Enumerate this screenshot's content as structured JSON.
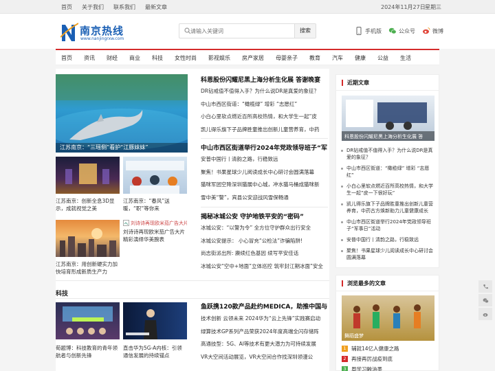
{
  "topbar": {
    "links": [
      "首页",
      "关于我们",
      "联系我们",
      "最新文章"
    ],
    "date": "2024年11月27日",
    "weekday": "星期三"
  },
  "logo": {
    "name": "南京热线",
    "domain": "www.nanjingrxw.com"
  },
  "search": {
    "placeholder": "请输入关键词",
    "button": "搜索"
  },
  "header_links": [
    "手机版",
    "公众号",
    "微博"
  ],
  "nav": [
    "首页",
    "资讯",
    "财经",
    "商业",
    "科技",
    "女性时尚",
    "影视娱乐",
    "房产家居",
    "母婴亲子",
    "教育",
    "汽车",
    "健康",
    "公益",
    "生活"
  ],
  "hero": {
    "caption": "江苏南京：“三瑶侧”看护“江豚妹妹”"
  },
  "thumbs": [
    {
      "caption": "江苏南京：创新全息3D显示，成就视觉之美"
    },
    {
      "caption": "江苏南京：“春风”送暖，“职”等你来"
    },
    {
      "caption": "江苏南京：用创新硬实力加快培育形成新质生产力"
    },
    {
      "caption": "刘诗诗再现欧米茄广告大片精彩演绎华美腕表",
      "alt": "刘诗诗再现欧米茄广告大片"
    }
  ],
  "news_groups": [
    {
      "lead": "科恩股份闪耀尼黑上海分析生化展 答谢晚宴",
      "items": [
        "DR钻戒值不值得入手？为什么说DR是真爱的象征？",
        "中山市西区街道：“橄榄绿” 增彩 “志愿红”",
        "小白心里软点燃近百所高校热情，和大学生一起”皮",
        "凯儿得乐旗下子品牌胜童推出创新儿童营养育，中药"
      ]
    },
    {
      "lead": "中山市西区街道举行2024年党政领导班子“军",
      "items": [
        "安普中国行丨清韵之路，行稳致远",
        "聚焦！书果星球少儿阅读成长中心研讨会圆满落幕",
        "猫咪军团空降深圳猫展中心城，冲水猫马桶成猫咪新",
        "雪中美“警”，宾县公安迎战风雪保畅通"
      ]
    },
    {
      "lead": "揭秘冰城公安 守护地铁平安的“密码”",
      "items": [
        "冰城公安：“以警为令” 全方位守护群众出行安全",
        "冰城公安提示： 小心冒充“公检法”诈骗陷阱!",
        "尚志街派出所: 赓续红色基因 续写平安佳话",
        "冰城公安“空中+地面”立体巡控 筑牢封江期冰面”安全"
      ]
    }
  ],
  "tech": {
    "title": "科技",
    "thumbs": [
      {
        "caption": "荀题博：科技教育的青年领航者与创新先锋"
      },
      {
        "caption": "直击华为5G-A内核：引领通信发展的持续锚点"
      }
    ],
    "lead": "鱼跃携120款产品赴约MEDICA，助推中国与",
    "items": [
      "技术创新 云领未来 2024华为“云上先锋”实践赛启动",
      "绿算技术GP系列产品荣获2024年度高端全闪存储阵",
      "高通技型：5G、AI等技术有更大潜力为可持续发展",
      "VR大空间活动展览，VR大空间合作找深圳领漫公"
    ]
  },
  "sidebar": {
    "recent_title": "近期文章",
    "recent_image_caption": "科恩股份闪耀尼黑上海分析生化展 答",
    "recent": [
      "DR钻戒值不值得入手？为什么说DR是真爱的象征？",
      "中山市西区街道：“橄榄绿” 增彩 “志愿红”",
      "小白心里软点燃近百所高校热情，和大学生一起”皮一下很好玩”",
      "凯儿得乐旗下子品牌胜童推出创新儿童营养育，中药古方焕新助力儿童健康成长",
      "中山市西区街道举行2024年党政领导班子“军事日”活动",
      "安普中国行丨清韵之路，行稳致远",
      "聚焦！书果星球少儿阅读成长中心研讨会圆满落幕"
    ],
    "popular_title": "浏览最多的文章",
    "popular_image_caption": "舞蹈盛梦",
    "popular": [
      {
        "n": "1",
        "text": "辅就14亿人健康之路"
      },
      {
        "n": "2",
        "text": "再接再厉战疫到底"
      },
      {
        "n": "3",
        "text": "周学习触油墨"
      }
    ]
  },
  "colors": {
    "accent": "#d42a2a",
    "brand": "#1a5fb4"
  },
  "icons": [
    "search-icon",
    "phone-icon",
    "wechat-icon",
    "weibo-icon"
  ]
}
